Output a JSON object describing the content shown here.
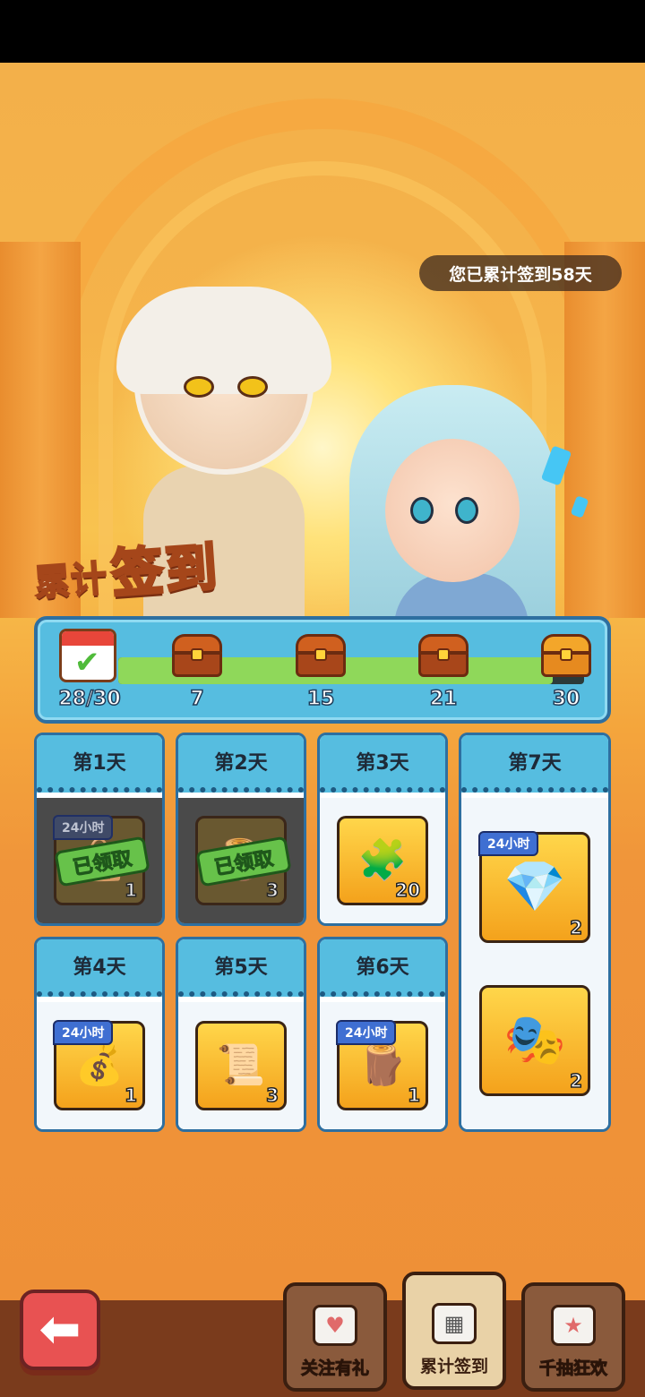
{
  "header": {
    "total_checkin_text": "您已累计签到58天"
  },
  "banner": {
    "title_part1": "累计",
    "title_part2": "签到"
  },
  "progress": {
    "current_label": "28/30",
    "current": 28,
    "max": 30,
    "milestones": [
      "7",
      "15",
      "21",
      "30"
    ]
  },
  "days": [
    {
      "label": "第1天",
      "tag": "24小时",
      "qty": "1",
      "stamp": "已领取",
      "icon": "grain-bag-icon"
    },
    {
      "label": "第2天",
      "tag": "",
      "qty": "3",
      "stamp": "已领取",
      "icon": "wood-bundle-icon"
    },
    {
      "label": "第3天",
      "tag": "",
      "qty": "20",
      "stamp": "",
      "icon": "gold-puzzle-icon"
    },
    {
      "label": "第4天",
      "tag": "24小时",
      "qty": "1",
      "stamp": "",
      "icon": "gem-sack-icon"
    },
    {
      "label": "第5天",
      "tag": "",
      "qty": "3",
      "stamp": "",
      "icon": "scroll-icon"
    },
    {
      "label": "第6天",
      "tag": "24小时",
      "qty": "1",
      "stamp": "",
      "icon": "log-icon"
    },
    {
      "label": "第7天",
      "tag": "24小时",
      "qty": "2",
      "qty2": "2",
      "icon": "purple-gem-chest-icon",
      "icon2": "gold-mask-icon"
    }
  ],
  "nav": {
    "back": "back-arrow-icon",
    "tabs": [
      {
        "label": "关注有礼",
        "icon": "gift-heart-icon"
      },
      {
        "label": "累计签到",
        "icon": "calendar-icon"
      },
      {
        "label": "千抽狂欢",
        "icon": "gift-star-icon"
      }
    ]
  },
  "colors": {
    "panel_blue": "#56bde0",
    "progress_green": "#8fd85a",
    "item_gold": "#ffd64a",
    "back_red": "#e85252"
  }
}
